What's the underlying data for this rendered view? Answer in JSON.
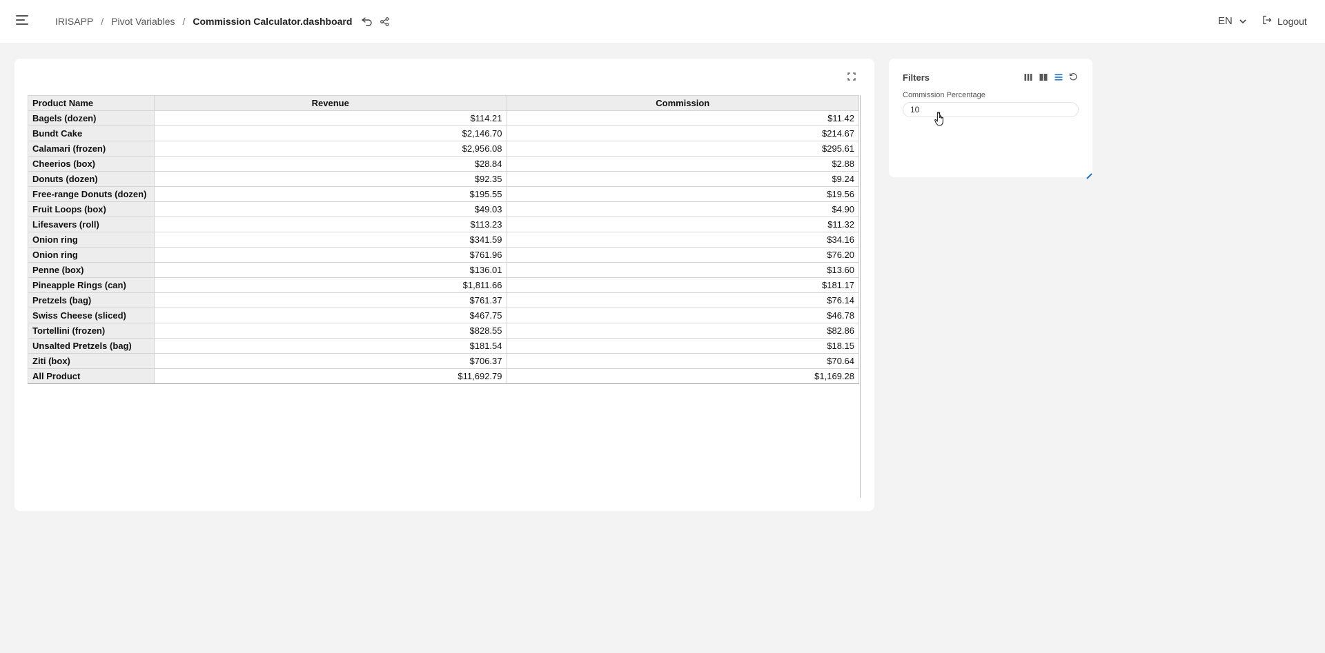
{
  "header": {
    "breadcrumb": [
      {
        "label": "IRISAPP"
      },
      {
        "label": "Pivot Variables"
      },
      {
        "label": "Commission Calculator.dashboard"
      }
    ],
    "separator": "/",
    "language": "EN",
    "logout_label": "Logout"
  },
  "pivot": {
    "columns": [
      "Product Name",
      "Revenue",
      "Commission"
    ],
    "rows": [
      {
        "name": "Bagels (dozen)",
        "revenue": "$114.21",
        "commission": "$11.42"
      },
      {
        "name": "Bundt Cake",
        "revenue": "$2,146.70",
        "commission": "$214.67"
      },
      {
        "name": "Calamari (frozen)",
        "revenue": "$2,956.08",
        "commission": "$295.61"
      },
      {
        "name": "Cheerios (box)",
        "revenue": "$28.84",
        "commission": "$2.88"
      },
      {
        "name": "Donuts (dozen)",
        "revenue": "$92.35",
        "commission": "$9.24"
      },
      {
        "name": "Free-range Donuts (dozen)",
        "revenue": "$195.55",
        "commission": "$19.56"
      },
      {
        "name": "Fruit Loops (box)",
        "revenue": "$49.03",
        "commission": "$4.90"
      },
      {
        "name": "Lifesavers (roll)",
        "revenue": "$113.23",
        "commission": "$11.32"
      },
      {
        "name": "Onion ring",
        "revenue": "$341.59",
        "commission": "$34.16"
      },
      {
        "name": "Onion ring",
        "revenue": "$761.96",
        "commission": "$76.20"
      },
      {
        "name": "Penne (box)",
        "revenue": "$136.01",
        "commission": "$13.60"
      },
      {
        "name": "Pineapple Rings (can)",
        "revenue": "$1,811.66",
        "commission": "$181.17"
      },
      {
        "name": "Pretzels (bag)",
        "revenue": "$761.37",
        "commission": "$76.14"
      },
      {
        "name": "Swiss Cheese (sliced)",
        "revenue": "$467.75",
        "commission": "$46.78"
      },
      {
        "name": "Tortellini (frozen)",
        "revenue": "$828.55",
        "commission": "$82.86"
      },
      {
        "name": "Unsalted Pretzels (bag)",
        "revenue": "$181.54",
        "commission": "$18.15"
      },
      {
        "name": "Ziti (box)",
        "revenue": "$706.37",
        "commission": "$70.64"
      }
    ],
    "total": {
      "name": "All Product",
      "revenue": "$11,692.79",
      "commission": "$1,169.28"
    }
  },
  "filters": {
    "title": "Filters",
    "field_label": "Commission Percentage",
    "field_value": "10"
  },
  "colors": {
    "accent": "#1a73c8",
    "header_bg": "#ffffff",
    "page_bg": "#f3f3f3",
    "cell_header_bg": "#ededed"
  }
}
